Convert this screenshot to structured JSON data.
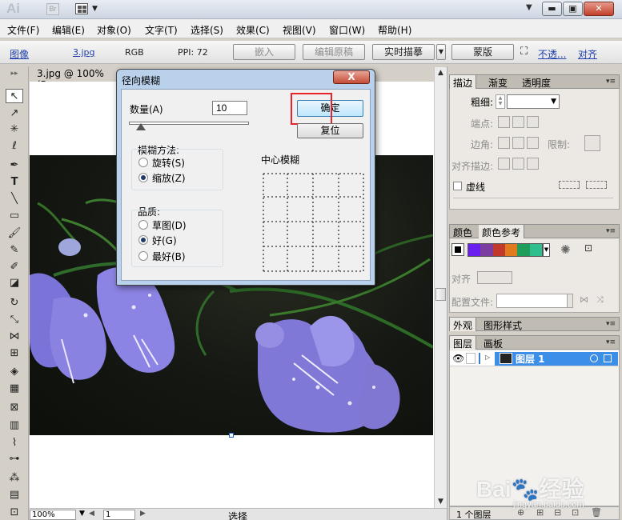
{
  "app": {
    "logo": "Ai",
    "bridge_label": "Br"
  },
  "menubar": {
    "items": [
      "文件(F)",
      "编辑(E)",
      "对象(O)",
      "文字(T)",
      "选择(S)",
      "效果(C)",
      "视图(V)",
      "窗口(W)",
      "帮助(H)"
    ]
  },
  "controlbar": {
    "image_label": "图像",
    "file_name": "3.jpg",
    "color_mode": "RGB",
    "ppi": "PPI: 72",
    "embed_label": "嵌入",
    "edit_original_label": "编辑原稿",
    "live_trace_label": "实时描摹",
    "mask_label": "蒙版",
    "opacity_label": "不透...",
    "align_label": "对齐"
  },
  "document": {
    "tab_title": "3.jpg @ 100% (R"
  },
  "statusbar": {
    "zoom": "100%",
    "page": "1",
    "status": "选择"
  },
  "dialog": {
    "title": "径向模糊",
    "close_label": "X",
    "amount_label": "数量(A)",
    "amount_value": "10",
    "ok_label": "确定",
    "reset_label": "复位",
    "blur_method_label": "模糊方法:",
    "methods": [
      {
        "label": "旋转(S)",
        "selected": false
      },
      {
        "label": "缩放(Z)",
        "selected": true
      }
    ],
    "quality_label": "品质:",
    "qualities": [
      {
        "label": "草图(D)",
        "selected": false
      },
      {
        "label": "好(G)",
        "selected": true
      },
      {
        "label": "最好(B)",
        "selected": false
      }
    ],
    "center_label": "中心模糊"
  },
  "panels": {
    "stroke": {
      "tabs": [
        "描边",
        "渐变",
        "透明度"
      ],
      "weight_label": "粗细:",
      "cap_label": "端点:",
      "corner_label": "边角:",
      "limit_label": "限制:",
      "align_stroke_label": "对齐描边:",
      "dashed_label": "虚线"
    },
    "color": {
      "tabs": [
        "颜色",
        "颜色参考"
      ],
      "align_label": "对齐",
      "profile_label": "配置文件:",
      "swatches": [
        "#6a1ff0",
        "#7b3ea0",
        "#c0392b",
        "#e07a1f",
        "#1e9e5a",
        "#2fbf8f"
      ]
    },
    "appearance": {
      "tabs": [
        "外观",
        "图形样式"
      ]
    },
    "layers": {
      "tabs": [
        "图层",
        "画板"
      ],
      "layer_name": "图层 1",
      "footer": "1 个图层"
    }
  },
  "watermark": {
    "logo": "Bai🐾经验",
    "url": "jingyan.baidu.com"
  }
}
